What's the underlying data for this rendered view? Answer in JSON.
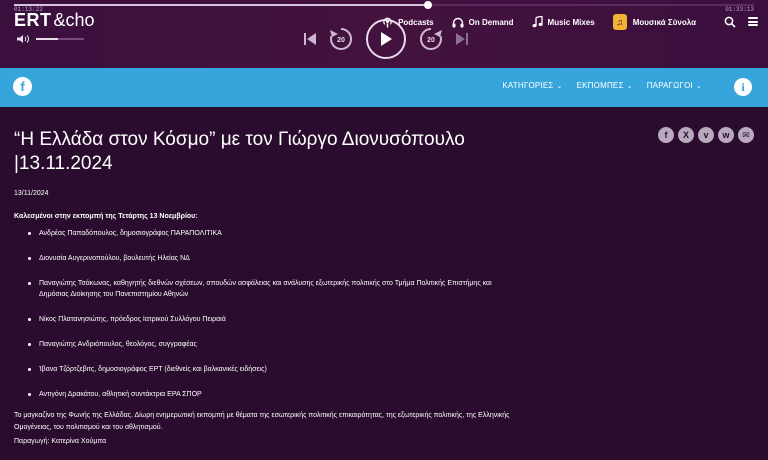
{
  "player": {
    "time_start": "01:13:22",
    "time_end": "01:33:13",
    "progress": 0.56,
    "volume": 0.45,
    "rewind_label": "20",
    "forward_label": "20"
  },
  "brand": {
    "ert": "ERT",
    "echo": "&cho"
  },
  "topnav": {
    "podcasts": "Podcasts",
    "on_demand": "On Demand",
    "music_mixes": "Music Mixes",
    "channel": "Μουσικά Σύνολα",
    "channel_badge": "♫"
  },
  "nav": {
    "facebook": "f",
    "items": [
      "ΚΑΤΗΓΟΡΙΕΣ",
      "ΕΚΠΟΜΠΕΣ",
      "ΠΑΡΑΓΩΓΟΙ"
    ],
    "info": "i"
  },
  "article": {
    "title": "“Η Ελλάδα στον Κόσμο” με τον Γιώργο Διονυσόπουλο |13.11.2024",
    "date": "13/11/2024",
    "guests_heading": "Καλεσμένοι στην εκπομπή της Τετάρτης 13 Νοεμβρίου:",
    "guests": [
      "Ανδρέας Παπαδόπουλος, δημοσιογράφος ΠΑΡΑΠΟΛΙΤΙΚΑ",
      "Διονυσία Αυγερινοπούλου, βουλευτής Ηλείας ΝΔ",
      "Παναγιώτης Τσάκωνας, καθηγητής διεθνών σχέσεων, σπουδών ασφάλειας και ανάλυσης εξωτερικής πολιτικής στο Τμήμα Πολιτικής Επιστήμης και Δημόσιας Διοίκησης του Πανεπιστημίου Αθηνών",
      "Νίκος Πλατανησιώτης, πρόεδρος Ιατρικού Συλλόγου Πειραιά",
      "Παναγιώτης Ανδριόπουλος, θεολόγος, συγγραφέας",
      "Ίβανα Τζόρτζεβιτς, δημοσιογράφος ΕΡΤ (διεθνείς και βαλκανικές ειδήσεις)",
      "Αντιγόνη Δρακάτου, αθλητική συντάκτρια ΕΡΑ ΣΠΟΡ"
    ],
    "description": "Το μαγκαζίνο της Φωνής της Ελλάδας. Δίωρη ενημερωτική εκπομπή με θέματα της εσωτερικής πολιτικής επικαιρότητας, της εξωτερικής πολιτικής, της Ελληνικής Ομογένειας, του πολιτισμού και του αθλητισμού.",
    "producer": "Παραγωγή: Κατερίνα Χούμπα"
  },
  "share": {
    "facebook": "f",
    "x": "X",
    "viber": "v",
    "whatsapp": "w",
    "email": "✉"
  },
  "colors": {
    "background": "#2a0d2e",
    "nav_blue": "#36a5dc",
    "accent_gold": "#f2b233"
  }
}
